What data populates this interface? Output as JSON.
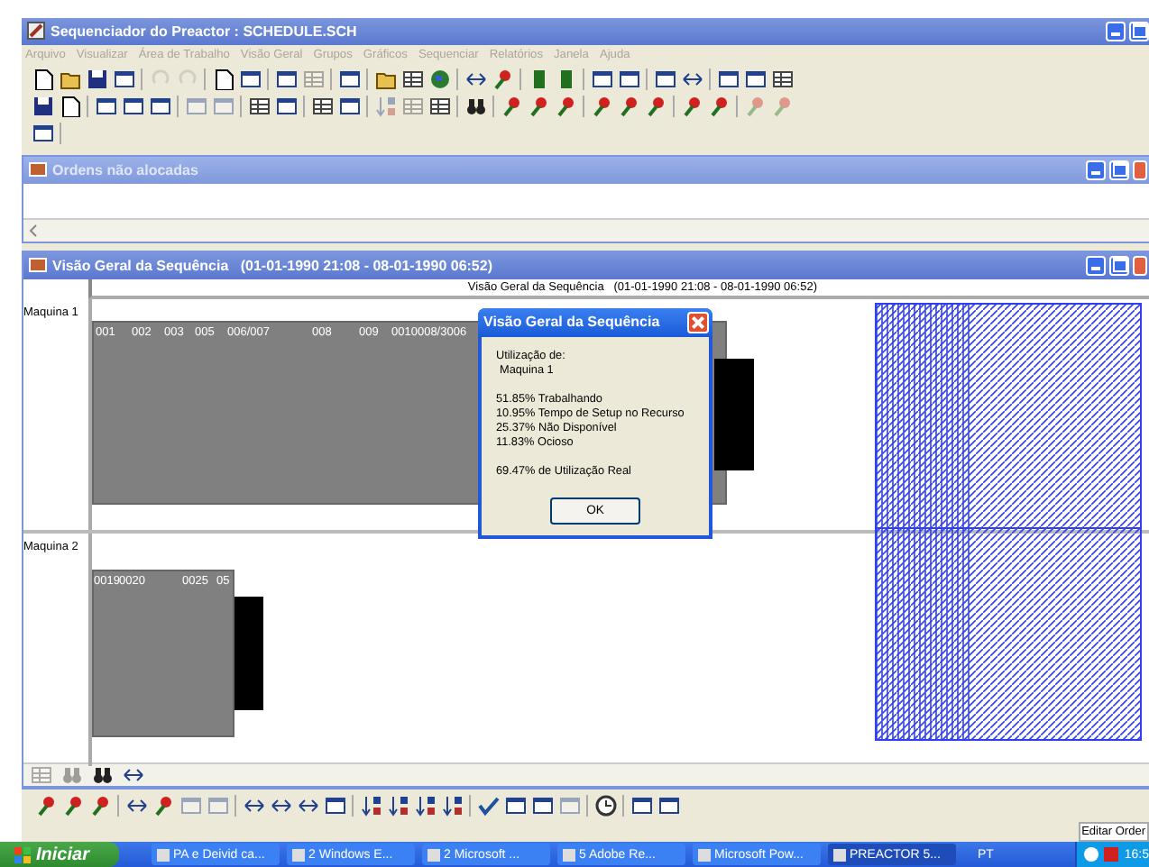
{
  "window": {
    "title": "Sequenciador do Preactor : SCHEDULE.SCH"
  },
  "menu": [
    {
      "label": "Arquivo",
      "disabled": true
    },
    {
      "label": "Visualizar",
      "disabled": true
    },
    {
      "label": "Área de Trabalho",
      "disabled": true
    },
    {
      "label": "Visão Geral",
      "disabled": true
    },
    {
      "label": "Grupos",
      "disabled": true
    },
    {
      "label": "Gráficos",
      "disabled": true
    },
    {
      "label": "Sequenciar",
      "disabled": true
    },
    {
      "label": "Relatórios",
      "disabled": true
    },
    {
      "label": "Janela",
      "disabled": true
    },
    {
      "label": "Ajuda",
      "disabled": true
    }
  ],
  "unallocated_window": {
    "title": "Ordens não alocadas"
  },
  "overview_window": {
    "title": "Visão Geral da Sequência   (01-01-1990 21:08 - 08-01-1990 06:52)"
  },
  "chart": {
    "header": "Visão Geral da Sequência   (01-01-1990 21:08 - 08-01-1990 06:52)",
    "resources": [
      {
        "name": "Maquina 1",
        "operations": [
          "001",
          "002",
          "003",
          "005",
          "006/007",
          "008",
          "009",
          "0010008/3006"
        ]
      },
      {
        "name": "Maquina 2",
        "operations": [
          "0019",
          "0020",
          "0025",
          "05"
        ]
      }
    ]
  },
  "dialog": {
    "title": "Visão Geral da Sequência",
    "heading": "Utilização de:",
    "resource": "Maquina 1",
    "stats": [
      "51.85% Trabalhando",
      "10.95% Tempo de Setup no Recurso",
      "25.37% Não Disponível",
      "11.83% Ocioso"
    ],
    "summary": "69.47% de Utilização Real",
    "button": "OK"
  },
  "status_bar": {
    "text": "Editar Order"
  },
  "taskbar": {
    "start": "Iniciar",
    "items": [
      {
        "label": "PA e Deivid ca...",
        "selected": false
      },
      {
        "label": "2 Windows E...",
        "selected": false
      },
      {
        "label": "2 Microsoft ...",
        "selected": false
      },
      {
        "label": "5 Adobe Re...",
        "selected": false
      },
      {
        "label": "Microsoft Pow...",
        "selected": false
      },
      {
        "label": "PREACTOR 5...",
        "selected": true
      }
    ],
    "language": "PT",
    "clock": "16:5"
  }
}
